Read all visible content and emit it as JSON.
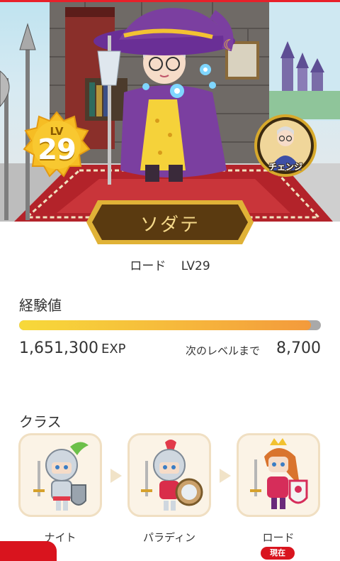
{
  "character": {
    "level_label": "LV",
    "level": "29",
    "name": "ソダテ",
    "change_label": "チェンジ"
  },
  "status": {
    "class_name": "ロード",
    "class_level": "LV29"
  },
  "experience": {
    "title": "経験値",
    "value": "1,651,300",
    "unit": "EXP",
    "next_label": "次のレベルまで",
    "next_value": "8,700",
    "progress_fraction": 0.966
  },
  "classes": {
    "title": "クラス",
    "items": [
      {
        "name": "ナイト"
      },
      {
        "name": "パラディン"
      },
      {
        "name": "ロード"
      }
    ],
    "current_badge": "現在"
  },
  "colors": {
    "accent_red": "#d9141e",
    "exp_gold": "#f6b53c",
    "plate_brown": "#5a3a10"
  }
}
